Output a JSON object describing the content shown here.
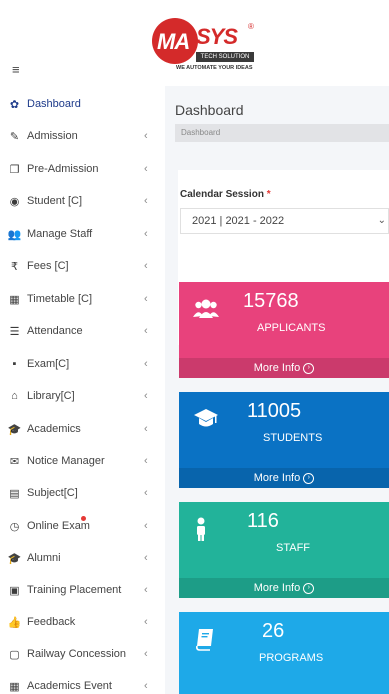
{
  "brand": {
    "logo_left": "MA",
    "logo_right": "SYS",
    "registered": "®",
    "tagline": "TECH SOLUTION",
    "slogan": "WE AUTOMATE YOUR IDEAS"
  },
  "sidebar": {
    "items": [
      {
        "label": "Dashboard",
        "icon": "palette-icon",
        "glyph": "✿",
        "chevron": ""
      },
      {
        "label": "Admission",
        "icon": "edit-icon",
        "glyph": "✎",
        "chevron": "‹"
      },
      {
        "label": "Pre-Admission",
        "icon": "copy-icon",
        "glyph": "❐",
        "chevron": "‹"
      },
      {
        "label": "Student [C]",
        "icon": "user-circle-icon",
        "glyph": "◉",
        "chevron": "‹"
      },
      {
        "label": "Manage Staff",
        "icon": "users-icon",
        "glyph": "👥",
        "chevron": "‹"
      },
      {
        "label": "Fees [C]",
        "icon": "rupee-icon",
        "glyph": "₹",
        "chevron": "‹"
      },
      {
        "label": "Timetable [C]",
        "icon": "calendar-icon",
        "glyph": "▦",
        "chevron": "‹"
      },
      {
        "label": "Attendance",
        "icon": "list-icon",
        "glyph": "☰",
        "chevron": "‹"
      },
      {
        "label": "Exam[C]",
        "icon": "note-icon",
        "glyph": "▪",
        "chevron": "‹"
      },
      {
        "label": "Library[C]",
        "icon": "bank-icon",
        "glyph": "⌂",
        "chevron": "‹"
      },
      {
        "label": "Academics",
        "icon": "graduation-cap-icon",
        "glyph": "🎓",
        "chevron": "‹"
      },
      {
        "label": "Notice Manager",
        "icon": "envelope-icon",
        "glyph": "✉",
        "chevron": "‹"
      },
      {
        "label": "Subject[C]",
        "icon": "book-icon",
        "glyph": "▤",
        "chevron": "‹"
      },
      {
        "label": "Online Exam",
        "icon": "clock-icon",
        "glyph": "◷",
        "chevron": "‹"
      },
      {
        "label": "Alumni",
        "icon": "graduation-cap-icon",
        "glyph": "🎓",
        "chevron": "‹"
      },
      {
        "label": "Training Placement",
        "icon": "briefcase-icon",
        "glyph": "▣",
        "chevron": "‹"
      },
      {
        "label": "Feedback",
        "icon": "thumbs-up-icon",
        "glyph": "👍",
        "chevron": "‹"
      },
      {
        "label": "Railway Concession",
        "icon": "train-icon",
        "glyph": "▢",
        "chevron": "‹"
      },
      {
        "label": "Academics Event",
        "icon": "calendar-icon",
        "glyph": "▦",
        "chevron": "‹"
      }
    ]
  },
  "header": {
    "page_title": "Dashboard",
    "breadcrumb": "Dashboard"
  },
  "session": {
    "label": "Calendar Session",
    "required_mark": "*",
    "value": "2021 | 2021 - 2022",
    "arrow": "⌄"
  },
  "stats": [
    {
      "value": "15768",
      "label": "APPLICANTS",
      "footer": "More Info",
      "icon": "users-icon",
      "color": "#e8427c"
    },
    {
      "value": "11005",
      "label": "STUDENTS",
      "footer": "More Info",
      "icon": "graduation-cap-icon",
      "color": "#0a72c4"
    },
    {
      "value": "116",
      "label": "STAFF",
      "footer": "More Info",
      "icon": "user-icon",
      "color": "#22b39a"
    },
    {
      "value": "26",
      "label": "PROGRAMS",
      "footer": "More Info",
      "icon": "book-icon",
      "color": "#1ea9e8"
    }
  ],
  "menu_toggle": "≡",
  "more_arrow": "›"
}
